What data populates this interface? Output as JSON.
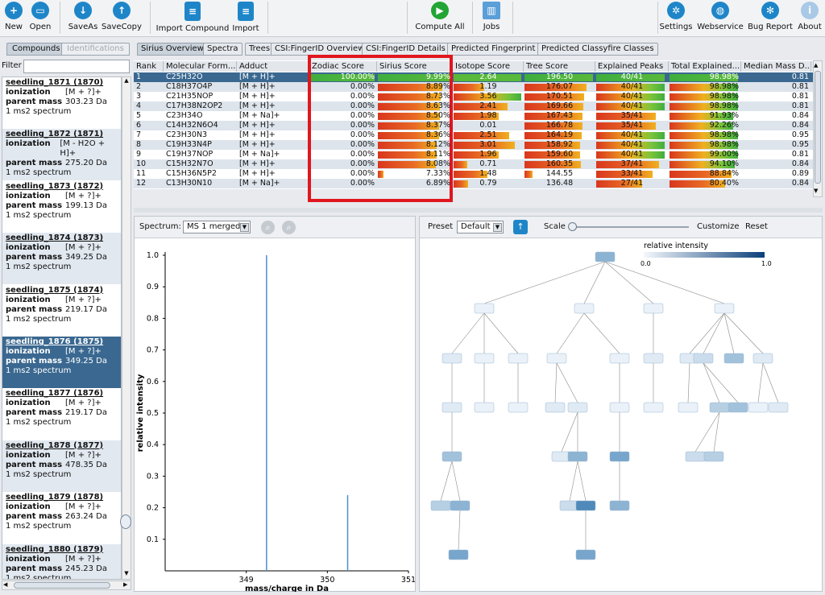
{
  "toolbar": {
    "new": "New",
    "open": "Open",
    "saveas": "SaveAs",
    "savecopy": "SaveCopy",
    "import_compound": "Import Compound",
    "import": "Import",
    "compute_all": "Compute All",
    "jobs": "Jobs",
    "settings": "Settings",
    "webservice": "Webservice",
    "bug_report": "Bug Report",
    "about": "About"
  },
  "left_tabs": {
    "compounds": "Compounds",
    "identifications": "Identifications"
  },
  "filter": {
    "label": "Filter",
    "value": ""
  },
  "compound_list": [
    {
      "title": "seedling_1871 (1870)",
      "ionization": "[M + ?]+",
      "mass": "303.23 Da",
      "spectra": "1 ms2 spectrum"
    },
    {
      "title": "seedling_1872 (1871)",
      "ionization": "[M - H2O + H]+",
      "mass": "275.20 Da",
      "spectra": "1 ms2 spectrum"
    },
    {
      "title": "seedling_1873 (1872)",
      "ionization": "[M + ?]+",
      "mass": "199.13 Da",
      "spectra": "1 ms2 spectrum"
    },
    {
      "title": "seedling_1874 (1873)",
      "ionization": "[M + ?]+",
      "mass": "349.25 Da",
      "spectra": "1 ms2 spectrum"
    },
    {
      "title": "seedling_1875 (1874)",
      "ionization": "[M + ?]+",
      "mass": "219.17 Da",
      "spectra": "1 ms2 spectrum"
    },
    {
      "title": "seedling_1876 (1875)",
      "ionization": "[M + ?]+",
      "mass": "349.25 Da",
      "spectra": "1 ms2 spectrum"
    },
    {
      "title": "seedling_1877 (1876)",
      "ionization": "[M + ?]+",
      "mass": "219.17 Da",
      "spectra": "1 ms2 spectrum"
    },
    {
      "title": "seedling_1878 (1877)",
      "ionization": "[M + ?]+",
      "mass": "478.35 Da",
      "spectra": "1 ms2 spectrum"
    },
    {
      "title": "seedling_1879 (1878)",
      "ionization": "[M + ?]+",
      "mass": "263.24 Da",
      "spectra": "1 ms2 spectrum"
    },
    {
      "title": "seedling_1880 (1879)",
      "ionization": "[M + ?]+",
      "mass": "245.23 Da",
      "spectra": "1 ms2 spectrum"
    }
  ],
  "compound_labels": {
    "ionization": "ionization",
    "parent_mass": "parent mass"
  },
  "result_tabs": [
    "Sirius Overview",
    "Spectra",
    "Trees",
    "CSI:FingerID Overview",
    "CSI:FingerID Details",
    "Predicted Fingerprint",
    "Predicted Classyfire Classes"
  ],
  "table": {
    "headers": [
      "Rank",
      "Molecular Form...",
      "Adduct",
      "Zodiac Score",
      "Sirius Score",
      "Isotope Score",
      "Tree Score",
      "Explained Peaks",
      "Total Explained...",
      "Median Mass D..."
    ],
    "rows": [
      {
        "rank": "1",
        "formula": "C25H32O",
        "adduct": "[M + H]+",
        "zodiac": "100.00%",
        "zodiac_frac": 1.0,
        "sirius": "9.99%",
        "sirius_frac": 1.0,
        "isotope": "2.64",
        "isotope_frac": 1.0,
        "tree": "196.50",
        "tree_frac": 1.0,
        "peaks": "40/41",
        "peaks_frac": 0.98,
        "total": "98.98%",
        "total_frac": 0.99,
        "median": "0.81"
      },
      {
        "rank": "2",
        "formula": "C18H37O4P",
        "adduct": "[M + H]+",
        "zodiac": "0.00%",
        "zodiac_frac": 0,
        "sirius": "8.89%",
        "sirius_frac": 0.89,
        "isotope": "1.19",
        "isotope_frac": 0.45,
        "tree": "176.07",
        "tree_frac": 0.9,
        "peaks": "40/41",
        "peaks_frac": 0.98,
        "total": "98.98%",
        "total_frac": 0.99,
        "median": "0.81"
      },
      {
        "rank": "3",
        "formula": "C21H35NOP",
        "adduct": "[M + H]+",
        "zodiac": "0.00%",
        "zodiac_frac": 0,
        "sirius": "8.73%",
        "sirius_frac": 0.87,
        "isotope": "3.56",
        "isotope_frac": 1.0,
        "tree": "170.51",
        "tree_frac": 0.87,
        "peaks": "40/41",
        "peaks_frac": 0.98,
        "total": "98.98%",
        "total_frac": 0.99,
        "median": "0.81"
      },
      {
        "rank": "4",
        "formula": "C17H38N2OP2",
        "adduct": "[M + H]+",
        "zodiac": "0.00%",
        "zodiac_frac": 0,
        "sirius": "8.63%",
        "sirius_frac": 0.86,
        "isotope": "2.41",
        "isotope_frac": 0.8,
        "tree": "169.66",
        "tree_frac": 0.86,
        "peaks": "40/41",
        "peaks_frac": 0.98,
        "total": "98.98%",
        "total_frac": 0.99,
        "median": "0.81"
      },
      {
        "rank": "5",
        "formula": "C23H34O",
        "adduct": "[M + Na]+",
        "zodiac": "0.00%",
        "zodiac_frac": 0,
        "sirius": "8.50%",
        "sirius_frac": 0.85,
        "isotope": "1.98",
        "isotope_frac": 0.67,
        "tree": "167.43",
        "tree_frac": 0.85,
        "peaks": "35/41",
        "peaks_frac": 0.85,
        "total": "91.93%",
        "total_frac": 0.92,
        "median": "0.84"
      },
      {
        "rank": "6",
        "formula": "C14H32N6O4",
        "adduct": "[M + H]+",
        "zodiac": "0.00%",
        "zodiac_frac": 0,
        "sirius": "8.37%",
        "sirius_frac": 0.84,
        "isotope": "0.01",
        "isotope_frac": 0.0,
        "tree": "166.78",
        "tree_frac": 0.85,
        "peaks": "35/41",
        "peaks_frac": 0.85,
        "total": "92.26%",
        "total_frac": 0.92,
        "median": "0.84"
      },
      {
        "rank": "7",
        "formula": "C23H30N3",
        "adduct": "[M + H]+",
        "zodiac": "0.00%",
        "zodiac_frac": 0,
        "sirius": "8.36%",
        "sirius_frac": 0.84,
        "isotope": "2.51",
        "isotope_frac": 0.82,
        "tree": "164.19",
        "tree_frac": 0.84,
        "peaks": "40/41",
        "peaks_frac": 0.98,
        "total": "98.98%",
        "total_frac": 0.99,
        "median": "0.95"
      },
      {
        "rank": "8",
        "formula": "C19H33N4P",
        "adduct": "[M + H]+",
        "zodiac": "0.00%",
        "zodiac_frac": 0,
        "sirius": "8.12%",
        "sirius_frac": 0.81,
        "isotope": "3.01",
        "isotope_frac": 0.9,
        "tree": "158.92",
        "tree_frac": 0.81,
        "peaks": "40/41",
        "peaks_frac": 0.98,
        "total": "98.98%",
        "total_frac": 0.99,
        "median": "0.95"
      },
      {
        "rank": "9",
        "formula": "C19H37NOP",
        "adduct": "[M + Na]+",
        "zodiac": "0.00%",
        "zodiac_frac": 0,
        "sirius": "8.11%",
        "sirius_frac": 0.81,
        "isotope": "1.96",
        "isotope_frac": 0.67,
        "tree": "159.60",
        "tree_frac": 0.81,
        "peaks": "40/41",
        "peaks_frac": 0.98,
        "total": "99.00%",
        "total_frac": 0.99,
        "median": "0.81"
      },
      {
        "rank": "10",
        "formula": "C15H32N7O",
        "adduct": "[M + H]+",
        "zodiac": "0.00%",
        "zodiac_frac": 0,
        "sirius": "8.08%",
        "sirius_frac": 0.8,
        "isotope": "0.71",
        "isotope_frac": 0.2,
        "tree": "160.35",
        "tree_frac": 0.82,
        "peaks": "37/41",
        "peaks_frac": 0.9,
        "total": "94.10%",
        "total_frac": 0.94,
        "median": "0.84"
      },
      {
        "rank": "11",
        "formula": "C15H36N5P2",
        "adduct": "[M + H]+",
        "zodiac": "0.00%",
        "zodiac_frac": 0,
        "sirius": "7.33%",
        "sirius_frac": 0.12,
        "isotope": "1.48",
        "isotope_frac": 0.5,
        "tree": "144.55",
        "tree_frac": 0.12,
        "peaks": "33/41",
        "peaks_frac": 0.8,
        "total": "88.84%",
        "total_frac": 0.89,
        "median": "0.89"
      },
      {
        "rank": "12",
        "formula": "C13H30N10",
        "adduct": "[M + Na]+",
        "zodiac": "0.00%",
        "zodiac_frac": 0,
        "sirius": "6.89%",
        "sirius_frac": 0,
        "isotope": "0.79",
        "isotope_frac": 0.22,
        "tree": "136.48",
        "tree_frac": 0,
        "peaks": "27/41",
        "peaks_frac": 0.66,
        "total": "80.40%",
        "total_frac": 0.8,
        "median": "0.84"
      }
    ]
  },
  "spectrum": {
    "label": "Spectrum:",
    "selected": "MS 1 merged"
  },
  "tree_panel": {
    "preset_label": "Preset",
    "preset_value": "Default",
    "scale_label": "Scale",
    "scale_value": 0.0,
    "customize": "Customize",
    "reset": "Reset",
    "legend_title": "relative intensity",
    "legend_min": "0.0",
    "legend_max": "1.0"
  },
  "colors": {
    "selected_row": "#3a6890",
    "zodiac_bar": "#3fae3f",
    "peak_line": "#4a90d0",
    "red_highlight": "#e0161e"
  },
  "chart_data": {
    "type": "bar",
    "title": "",
    "xlabel": "mass/charge in Da",
    "ylabel": "relative intensity",
    "xlim": [
      348.0,
      351.0
    ],
    "ylim": [
      0,
      1.0
    ],
    "xticks": [
      "349",
      "350",
      "351"
    ],
    "yticks": [
      "0.1",
      "0.2",
      "0.3",
      "0.4",
      "0.5",
      "0.6",
      "0.7",
      "0.8",
      "0.9",
      "1.0"
    ],
    "peaks": [
      {
        "x": 349.25,
        "y": 1.0
      },
      {
        "x": 350.25,
        "y": 0.24
      }
    ]
  }
}
